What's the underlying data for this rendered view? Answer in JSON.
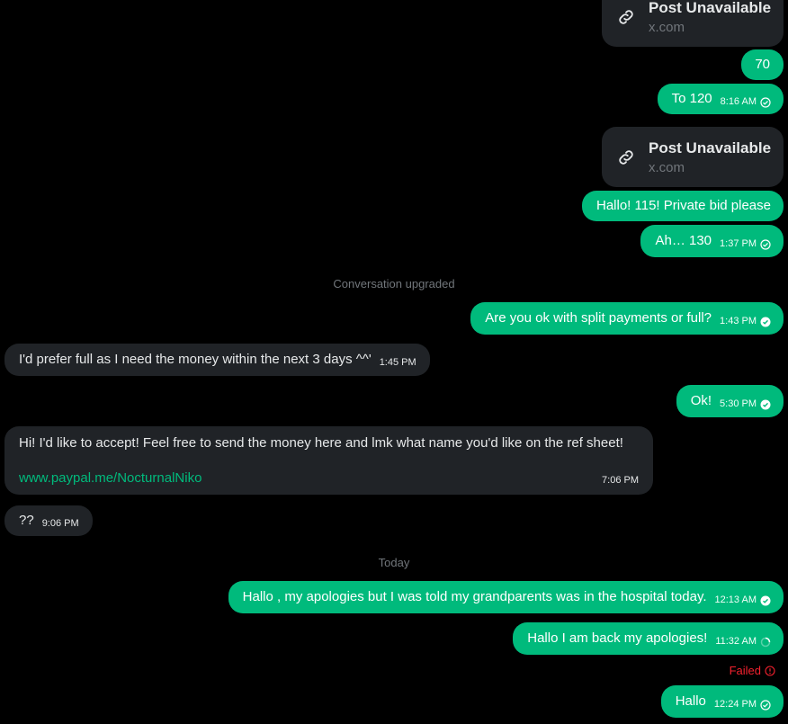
{
  "cards": [
    {
      "title": "Post Unavailable",
      "domain": "x.com"
    },
    {
      "title": "Post Unavailable",
      "domain": "x.com"
    }
  ],
  "messages": [
    {
      "text": "70",
      "time": ""
    },
    {
      "text": "To 120",
      "time": "8:16 AM"
    },
    {
      "text": "Hallo! 115! Private bid please",
      "time": ""
    },
    {
      "text": "Ah… 130",
      "time": "1:37 PM"
    },
    {
      "text": "Are you ok with split payments or full?",
      "time": "1:43 PM"
    },
    {
      "text": "I'd prefer full as I need the money within the next 3 days ^^'",
      "time": "1:45 PM"
    },
    {
      "text": "Ok!",
      "time": "5:30 PM"
    },
    {
      "text": "Hi! I'd like to accept! Feel free to send the money here and lmk what name you'd like on the ref sheet!",
      "link": "www.paypal.me/NocturnalNiko",
      "time": "7:06 PM"
    },
    {
      "text": "??",
      "time": "9:06 PM"
    },
    {
      "text": "Hallo , my apologies but I was told my grandparents was in the hospital today.",
      "time": "12:13 AM"
    },
    {
      "text": "Hallo I am back my apologies!",
      "time": "11:32 AM"
    },
    {
      "text": "Hallo",
      "time": "12:24 PM"
    }
  ],
  "dividers": {
    "upgraded": "Conversation upgraded",
    "today": "Today"
  },
  "failed_label": "Failed",
  "colors": {
    "outgoing": "#00ba7c",
    "incoming": "#202327",
    "link": "#00ba7c",
    "failed": "#f4212e"
  }
}
